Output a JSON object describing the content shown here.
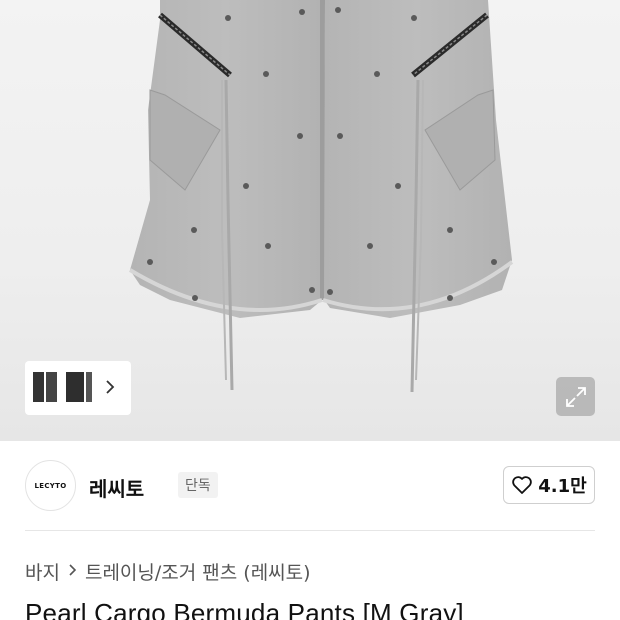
{
  "product_image": {
    "alt": "",
    "thumbnail_count": 1
  },
  "brand": {
    "logo_text": "LECYTO",
    "name": "레씨토",
    "badge": "단독"
  },
  "like": {
    "count": "4.1만",
    "icon": "heart-icon"
  },
  "breadcrumb": {
    "category": "바지",
    "subcategory": "트레이닝/조거 팬츠 (레씨토)",
    "separator_icon": "chevron-right-icon"
  },
  "product": {
    "title": "Pearl Cargo Bermuda Pants  [M Gray]"
  },
  "icons": {
    "zoom": "expand-arrows-icon",
    "thumb_next": "chevron-right-icon"
  },
  "colors": {
    "fabric": "#b9b9b9",
    "background": "#eeeeee"
  }
}
